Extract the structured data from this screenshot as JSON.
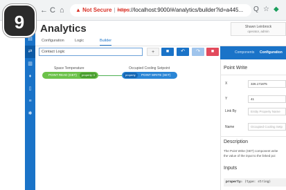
{
  "step_badge": "9",
  "browser": {
    "not_secure": "Not Secure",
    "url_scheme": "https",
    "url_rest": "://localhost:9000/#/analytics/builder?id=a445..."
  },
  "app": {
    "title": "Analytics",
    "user_name": "Shawn Leinbrock",
    "user_role": "operator, admin",
    "tabs": [
      {
        "label": "Configuration",
        "active": false
      },
      {
        "label": "Logic",
        "active": false
      },
      {
        "label": "Builder",
        "active": true
      }
    ]
  },
  "editor": {
    "name_value": "Contact Logic",
    "toolbar": [
      {
        "icon": "plus-icon",
        "glyph": "+"
      },
      {
        "icon": "save-icon",
        "glyph": "■"
      },
      {
        "icon": "undo-icon",
        "glyph": "↶"
      },
      {
        "icon": "redo-icon",
        "glyph": "↷"
      },
      {
        "icon": "delete-icon",
        "glyph": "■"
      }
    ]
  },
  "canvas": {
    "nodes": [
      {
        "title": "Space Temperature",
        "label": "POINT READ (GET)",
        "port": "property: 0"
      },
      {
        "title": "Occupied Cooling Setpoint",
        "label": "POINT WRITE (SET)",
        "port": "property"
      }
    ]
  },
  "panel": {
    "tabs": [
      "Components",
      "Configuration"
    ],
    "heading": "Point Write",
    "fields": [
      {
        "label": "X",
        "value": "326.171875",
        "placeholder": false
      },
      {
        "label": "Y",
        "value": "41",
        "placeholder": false
      },
      {
        "label": "Link By",
        "value": "Entity Property Name",
        "placeholder": true
      },
      {
        "label": "Name",
        "value": "Occupied Cooling Setp",
        "placeholder": true
      }
    ],
    "description_heading": "Description",
    "description_lines": [
      "The Point Write (SET) component write",
      "the value of the input to the linked poi"
    ],
    "inputs_heading": "Inputs",
    "input_code_name": "property:",
    "input_code_type": "(type: string)"
  },
  "colors": {
    "accent": "#1a73c8",
    "read_node": "#6cc24a",
    "write_node": "#2a86d6",
    "delete": "#e24a5c"
  }
}
